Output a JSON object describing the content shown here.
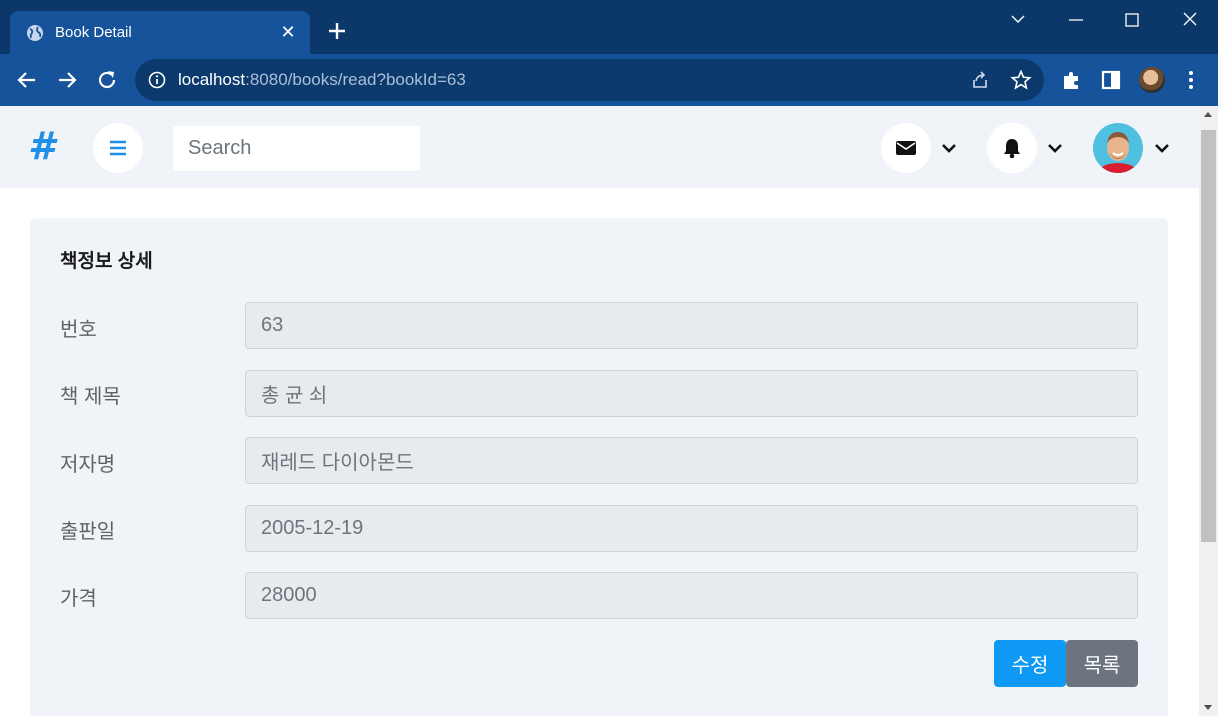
{
  "browser": {
    "tab_title": "Book Detail",
    "tab_close": "✕",
    "url_host": "localhost",
    "url_rest": ":8080/books/read?bookId=63"
  },
  "nav": {
    "brand": "#",
    "search_placeholder": "Search"
  },
  "card": {
    "title": "책정보 상세",
    "fields": [
      {
        "label": "번호",
        "value": "63"
      },
      {
        "label": "책 제목",
        "value": "총 균 쇠"
      },
      {
        "label": "저자명",
        "value": "재레드 다이아몬드"
      },
      {
        "label": "출판일",
        "value": "2005-12-19"
      },
      {
        "label": "가격",
        "value": "28000"
      }
    ],
    "edit_label": "수정",
    "list_label": "목록"
  },
  "colors": {
    "brand": "#1f8fe8",
    "edit_button": "#0d99f4",
    "list_button": "#6c7480"
  },
  "icons": [
    "globe-icon",
    "close-icon",
    "plus-icon",
    "back-icon",
    "forward-icon",
    "reload-icon",
    "info-icon",
    "share-icon",
    "star-icon",
    "puzzle-icon",
    "sidepanel-icon",
    "kebab-icon",
    "menu-icon",
    "envelope-icon",
    "bell-icon",
    "chevron-down-icon"
  ]
}
